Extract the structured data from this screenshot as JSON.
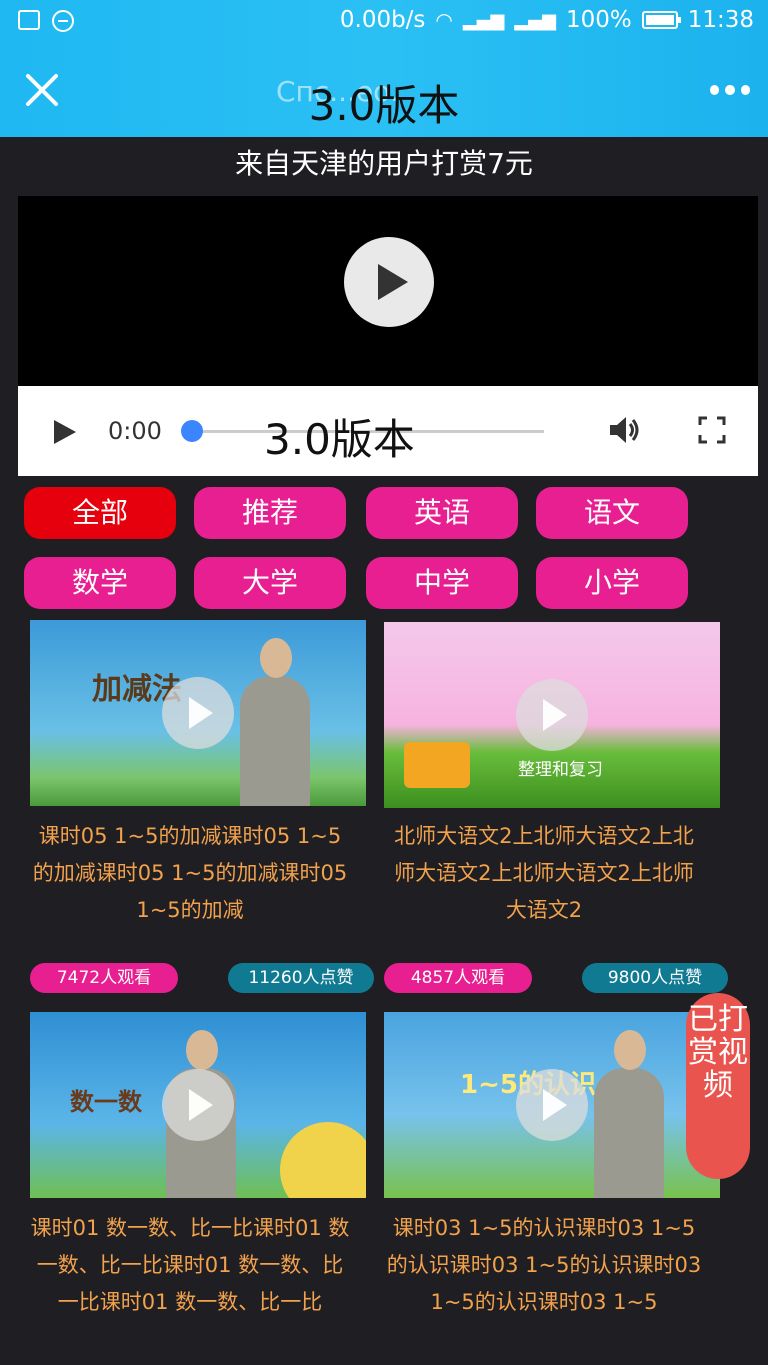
{
  "status_bar": {
    "speed": "0.00b/s",
    "battery": "100%",
    "time": "11:38"
  },
  "header": {
    "title_behind": "Спс...ео.",
    "title": "3.0版本"
  },
  "banner": "来自天津的用户打赏7元",
  "player": {
    "time": "0:00",
    "watermark": "3.0版本",
    "progress": 0
  },
  "categories": [
    "全部",
    "推荐",
    "英语",
    "语文",
    "数学",
    "大学",
    "中学",
    "小学"
  ],
  "videos": [
    {
      "title": "课时05 1~5的加减课时05 1~5的加减课时05 1~5的加减课时05 1~5的加减",
      "views": "7472人观看",
      "likes": "11260人点赞",
      "thumb_text": "加减法"
    },
    {
      "title": "北师大语文2上北师大语文2上北师大语文2上北师大语文2上北师大语文2",
      "views": "4857人观看",
      "likes": "9800人点赞",
      "thumb_text": "整理和复习"
    },
    {
      "title": "课时01 数一数、比一比课时01 数一数、比一比课时01 数一数、比一比课时01 数一数、比一比",
      "views": "",
      "likes": "",
      "thumb_text": "数一数"
    },
    {
      "title": "课时03 1~5的认识课时03 1~5的认识课时03 1~5的认识课时03 1~5的认识课时03 1~5",
      "views": "",
      "likes": "",
      "thumb_text": "1~5的认识"
    }
  ],
  "reward_button": "已打赏视频",
  "colors": {
    "topbar": "#1fb8f2",
    "chip": "#e81f91",
    "chip_active": "#e6000d",
    "title_text": "#f2a24d",
    "likes_pill": "#117a93",
    "reward": "#e9554e"
  }
}
